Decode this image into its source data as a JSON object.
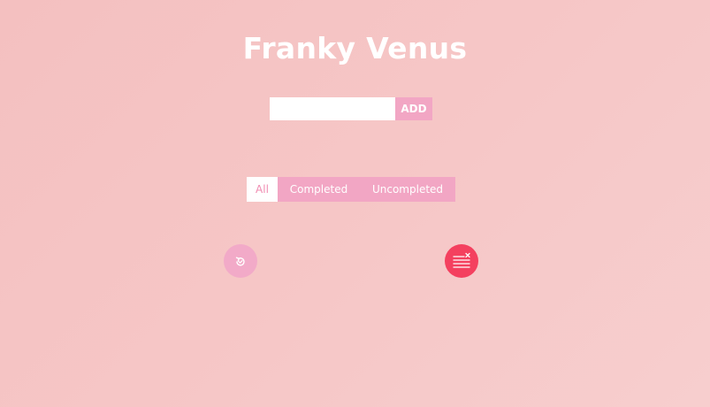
{
  "app": {
    "title": "Franky Venus"
  },
  "add_form": {
    "input_value": "",
    "input_placeholder": "",
    "add_label": "ADD"
  },
  "filters": {
    "tabs": [
      {
        "label": "All",
        "active": true
      },
      {
        "label": "Completed",
        "active": false
      },
      {
        "label": "Uncompleted",
        "active": false
      }
    ]
  },
  "actions": {
    "refresh_icon": "refresh-icon",
    "clear_icon": "clear-list-icon"
  },
  "colors": {
    "background": "#f6c6c6",
    "accent_pink": "#f2a6c4",
    "danger": "#f4405f",
    "text_light": "#ffffff"
  }
}
